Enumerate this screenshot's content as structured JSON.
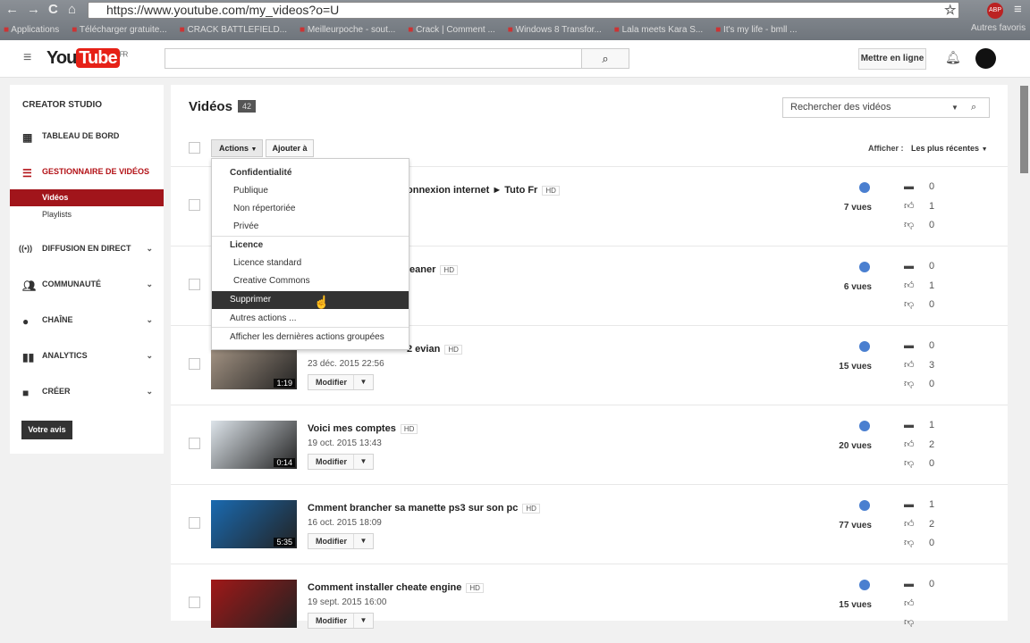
{
  "browser": {
    "url": "https://www.youtube.com/my_videos?o=U",
    "bookmarks": [
      "Applications",
      "Télécharger gratuite...",
      "CRACK BATTLEFIELD...",
      "Meilleurpoche - sout...",
      "Crack | Comment ...",
      "Windows 8 Transfor...",
      "Lala meets Kara S...",
      "It's my life - bmll ..."
    ],
    "other_bookmarks": "Autres favoris",
    "abp": "ABP"
  },
  "header": {
    "logo_you": "You",
    "logo_tube": "Tube",
    "logo_region": "FR",
    "search_value": "",
    "upload_label": "Mettre en ligne"
  },
  "sidebar": {
    "title": "CREATOR STUDIO",
    "items": [
      {
        "label": "TABLEAU DE BORD",
        "icon": "dashboard-icon"
      },
      {
        "label": "GESTIONNAIRE DE VIDÉOS",
        "icon": "video-manager-icon",
        "active": true
      },
      {
        "label": "Vidéos"
      },
      {
        "label": "Playlists"
      },
      {
        "label": "DIFFUSION EN DIRECT",
        "icon": "live-icon"
      },
      {
        "label": "COMMUNAUTÉ",
        "icon": "community-icon"
      },
      {
        "label": "CHAÎNE",
        "icon": "channel-icon"
      },
      {
        "label": "ANALYTICS",
        "icon": "analytics-icon"
      },
      {
        "label": "CRÉER",
        "icon": "create-icon"
      }
    ],
    "feedback": "Votre avis"
  },
  "main": {
    "title": "Vidéos",
    "count": "42",
    "actions": "Actions",
    "add_to": "Ajouter à",
    "search_placeholder": "Rechercher des vidéos",
    "show_label": "Afficher :",
    "sort": "Les plus récentes",
    "edit_label": "Modifier",
    "videos": [
      {
        "title": "onnexion internet ► Tuto Fr",
        "hd": "HD",
        "date": "",
        "duration": "",
        "views": "7 vues",
        "comments": "0",
        "likes": "1",
        "dislikes": "0",
        "partial": true
      },
      {
        "title": "leaner",
        "hd": "HD",
        "date": "",
        "duration": "",
        "views": "6 vues",
        "comments": "0",
        "likes": "1",
        "dislikes": "0",
        "partial": true
      },
      {
        "title": "2 evian",
        "hd": "HD",
        "date": "23 déc. 2015 22:56",
        "duration": "1:19",
        "views": "15 vues",
        "comments": "0",
        "likes": "3",
        "dislikes": "0",
        "partial": true
      },
      {
        "title": "Voici mes comptes",
        "hd": "HD",
        "date": "19 oct. 2015 13:43",
        "duration": "0:14",
        "views": "20 vues",
        "comments": "1",
        "likes": "2",
        "dislikes": "0"
      },
      {
        "title": "Cmment brancher sa manette ps3 sur son pc",
        "hd": "HD",
        "date": "16 oct. 2015 18:09",
        "duration": "5:35",
        "views": "77 vues",
        "comments": "1",
        "likes": "2",
        "dislikes": "0"
      },
      {
        "title": "Comment installer cheate engine",
        "hd": "HD",
        "date": "19 sept. 2015 16:00",
        "duration": "",
        "views": "15 vues",
        "comments": "0",
        "likes": "",
        "dislikes": ""
      }
    ]
  },
  "dropdown": {
    "items": [
      {
        "label": "Confidentialité",
        "header": true
      },
      {
        "label": "Publique"
      },
      {
        "label": "Non répertoriée"
      },
      {
        "label": "Privée"
      },
      {
        "label": "Licence",
        "header": true
      },
      {
        "label": "Licence standard"
      },
      {
        "label": "Creative Commons"
      },
      {
        "label": "Supprimer",
        "selected": true
      },
      {
        "label": "Autres actions ..."
      },
      {
        "label": "Afficher les dernières actions groupées"
      }
    ]
  }
}
